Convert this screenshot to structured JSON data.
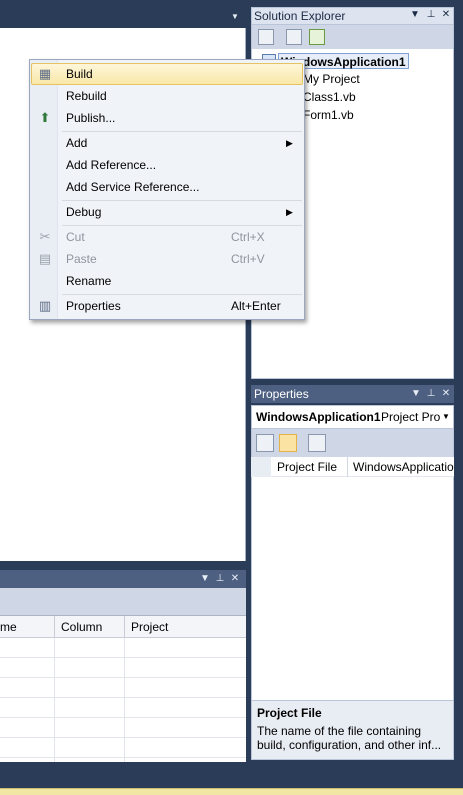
{
  "solution_explorer": {
    "title": "Solution Explorer",
    "tree": {
      "project": "WindowsApplication1",
      "items": [
        "My Project",
        "Class1.vb",
        "Form1.vb"
      ]
    }
  },
  "properties": {
    "title": "Properties",
    "object_name": "WindowsApplication1",
    "object_type": "Project Pro",
    "rows": [
      {
        "name": "Project File",
        "value": "WindowsApplicatio"
      }
    ],
    "description": {
      "title": "Project File",
      "text": "The name of the file containing build, configuration, and other inf..."
    }
  },
  "error_list": {
    "columns": [
      "me",
      "Column",
      "Project"
    ]
  },
  "context_menu": {
    "build": "Build",
    "rebuild": "Rebuild",
    "publish": "Publish...",
    "add": "Add",
    "add_reference": "Add Reference...",
    "add_service_reference": "Add Service Reference...",
    "debug": "Debug",
    "cut": "Cut",
    "cut_shortcut": "Ctrl+X",
    "paste": "Paste",
    "paste_shortcut": "Ctrl+V",
    "rename": "Rename",
    "properties": "Properties",
    "properties_shortcut": "Alt+Enter"
  },
  "icons": {
    "dropdown": "▼",
    "pin": "⊥",
    "close": "✕",
    "submenu": "▶"
  },
  "colors": {
    "ide_background": "#2b3c59",
    "menu_hover": "#f9e8a8",
    "panel_header_active": "#dde4ef",
    "panel_header_inactive": "#4d6082"
  }
}
